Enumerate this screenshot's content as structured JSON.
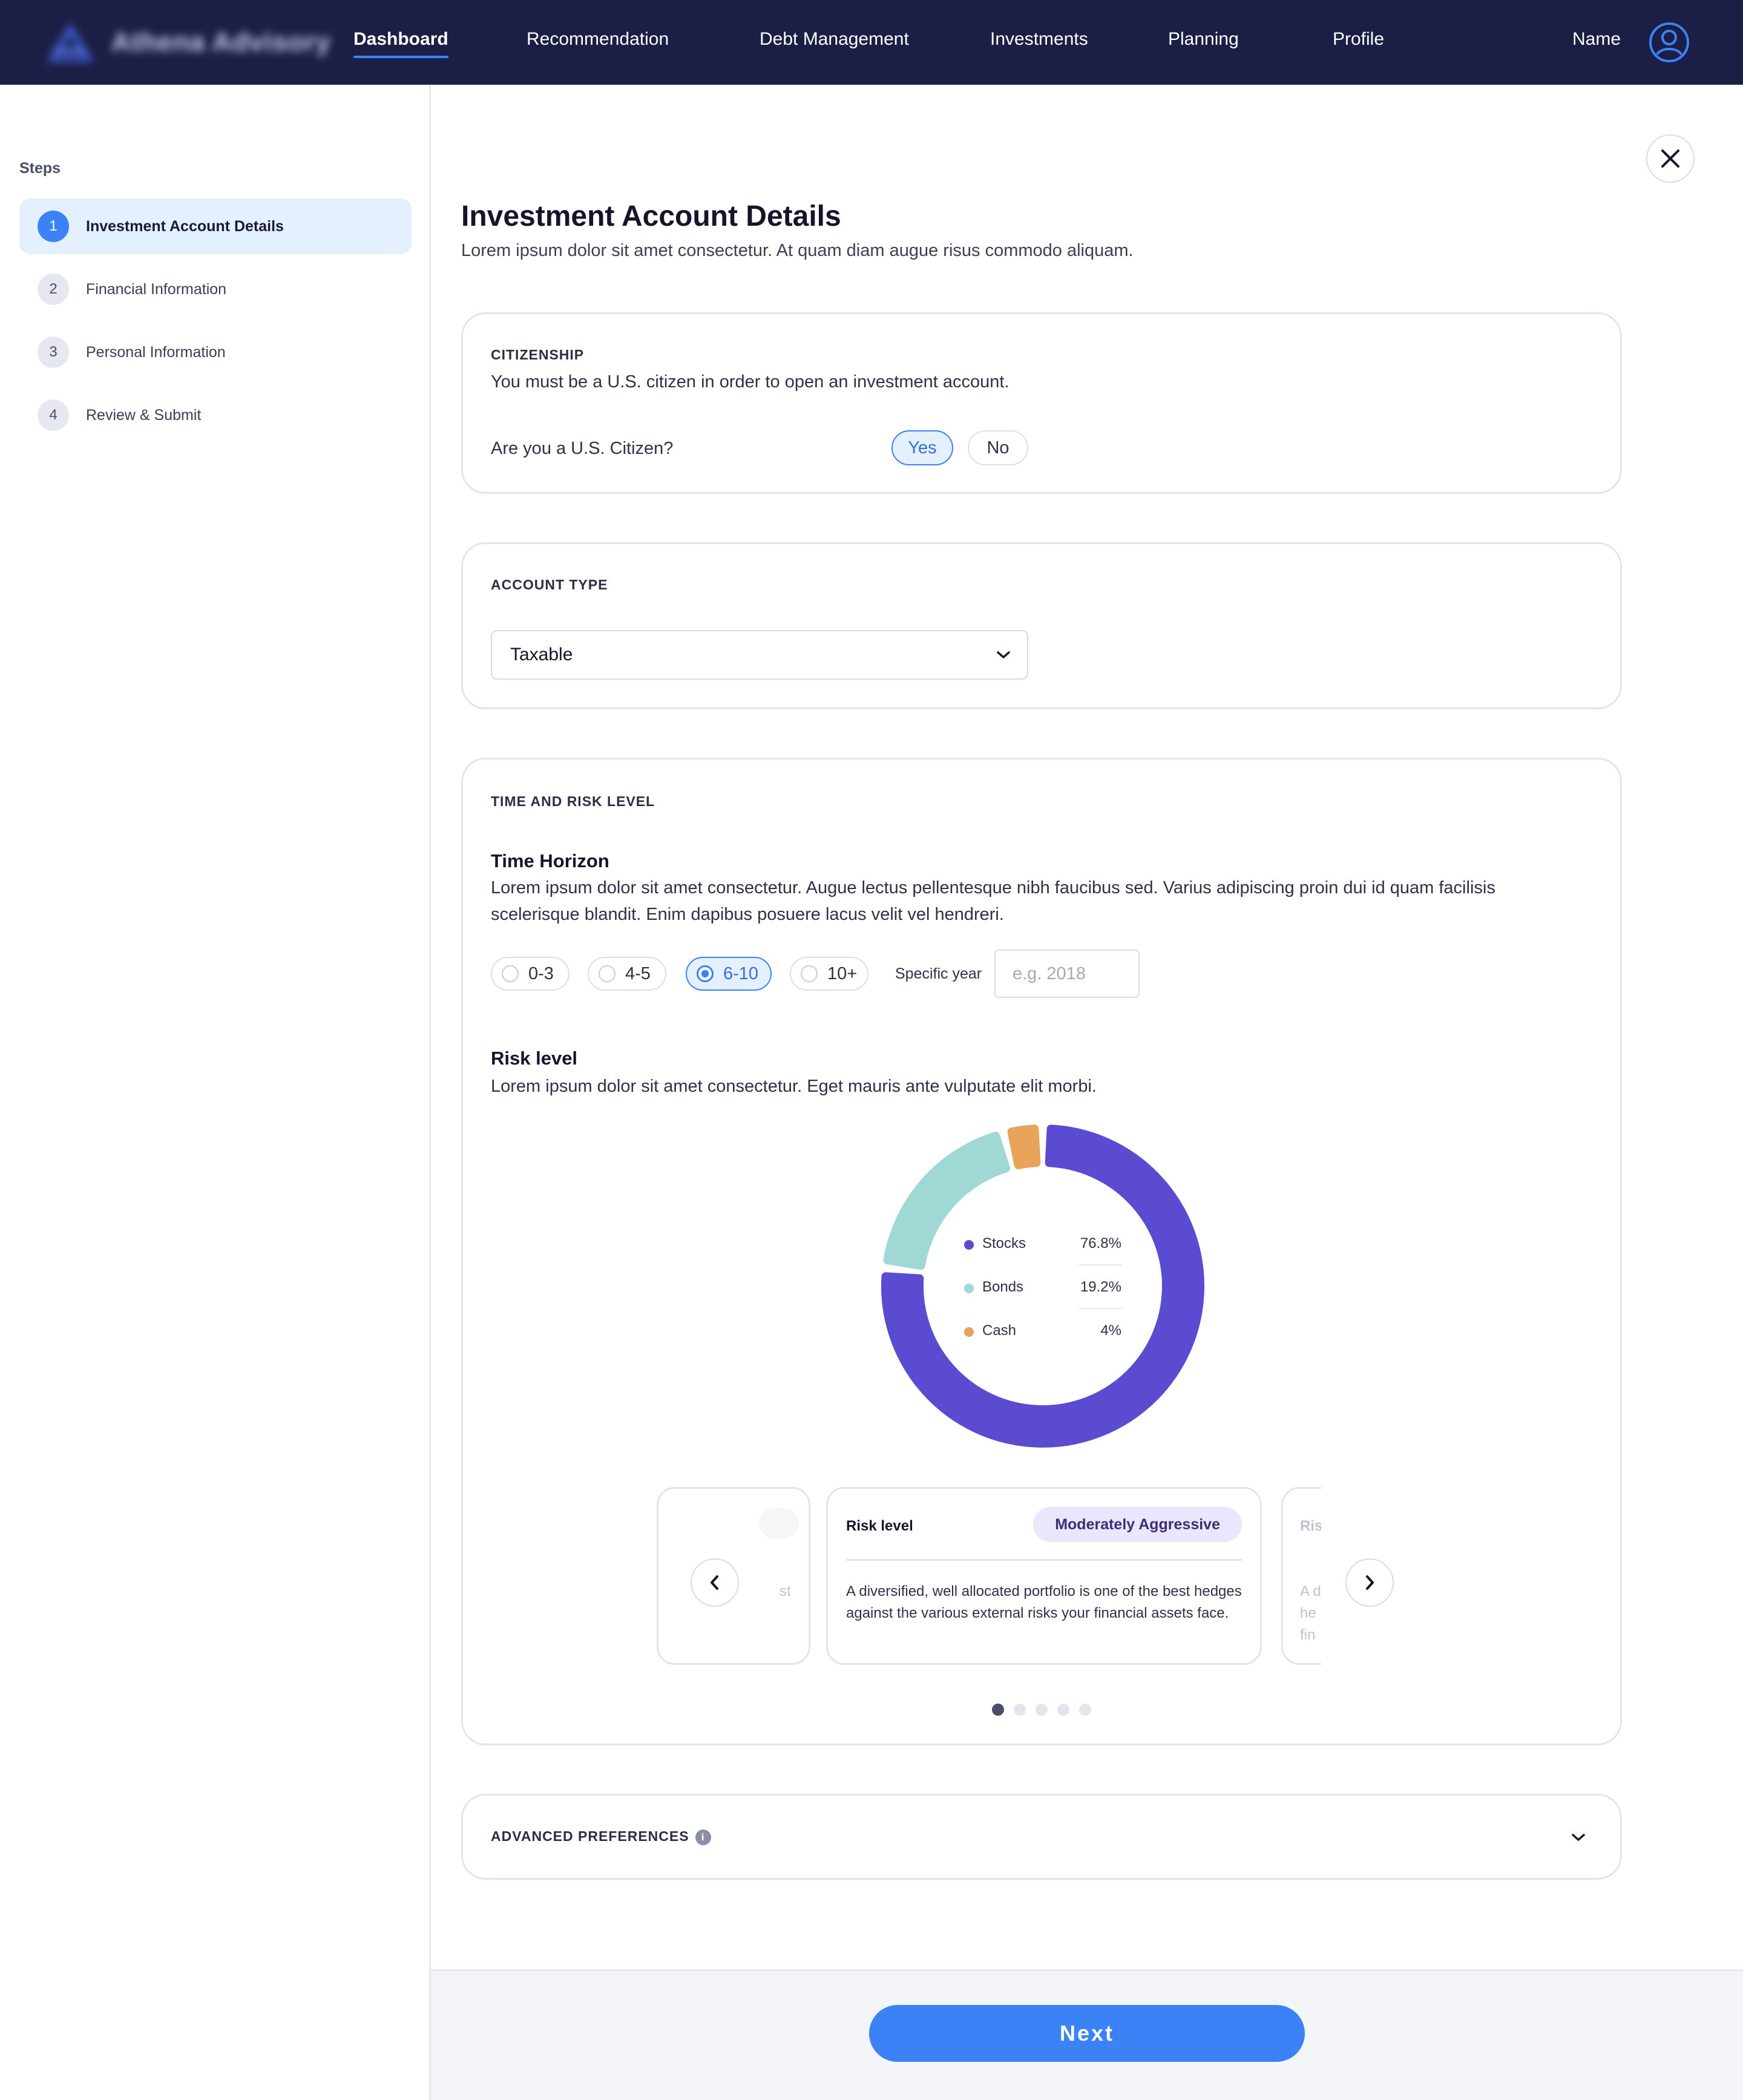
{
  "nav": {
    "brand": "Athena Advisory",
    "items": [
      {
        "label": "Dashboard",
        "active": true
      },
      {
        "label": "Recommendation"
      },
      {
        "label": "Debt Management"
      },
      {
        "label": "Investments"
      },
      {
        "label": "Planning"
      },
      {
        "label": "Profile"
      }
    ],
    "user_name": "Name"
  },
  "sidebar": {
    "title": "Steps",
    "steps": [
      {
        "num": "1",
        "label": "Investment Account Details",
        "active": true
      },
      {
        "num": "2",
        "label": "Financial Information"
      },
      {
        "num": "3",
        "label": "Personal Information"
      },
      {
        "num": "4",
        "label": "Review & Submit"
      }
    ]
  },
  "page": {
    "title": "Investment Account Details",
    "subtitle": "Lorem ipsum dolor sit amet consectetur. At quam diam augue risus commodo aliquam."
  },
  "citizenship": {
    "label": "CITIZENSHIP",
    "description": "You must be a U.S. citizen in order to open an investment account.",
    "question": "Are you a U.S. Citizen?",
    "yes": "Yes",
    "no": "No",
    "selected": "Yes"
  },
  "account_type": {
    "label": "ACCOUNT TYPE",
    "value": "Taxable"
  },
  "time_risk": {
    "label": "TIME AND RISK LEVEL",
    "horizon_title": "Time Horizon",
    "horizon_desc_1": "Lorem ipsum dolor sit amet consectetur. Augue lectus pellentesque nibh faucibus sed. Varius adipiscing proin dui id quam facilisis",
    "horizon_desc_2": "scelerisque blandit. Enim dapibus posuere lacus velit vel hendreri.",
    "options": [
      "0-3",
      "4-5",
      "6-10",
      "10+"
    ],
    "selected_option": "6-10",
    "specific_year_label": "Specific year",
    "specific_year_placeholder": "e.g. 2018",
    "risk_title": "Risk level",
    "risk_desc": "Lorem ipsum dolor sit amet consectetur. Eget mauris ante vulputate elit morbi."
  },
  "chart_data": {
    "type": "pie",
    "categories": [
      "Stocks",
      "Bonds",
      "Cash"
    ],
    "values": [
      76.8,
      19.2,
      4
    ],
    "labels": [
      "76.8%",
      "19.2%",
      "4%"
    ],
    "colors": [
      "#5b4bd0",
      "#9fd8d4",
      "#e8a45a"
    ],
    "legend": "center"
  },
  "carousel": {
    "prev_partial_text": "st",
    "current": {
      "title": "Risk level",
      "badge": "Moderately Aggressive",
      "text": "A diversified, well allocated portfolio is one of the best hedges against the various external risks your financial assets face."
    },
    "next_partial_title": "Ris",
    "next_partial_lines": [
      "A d",
      "he",
      "fin"
    ],
    "dot_count": 5,
    "active_dot": 0
  },
  "advanced": {
    "label": "ADVANCED PREFERENCES",
    "info": "i"
  },
  "footer": {
    "next_label": "Next"
  }
}
